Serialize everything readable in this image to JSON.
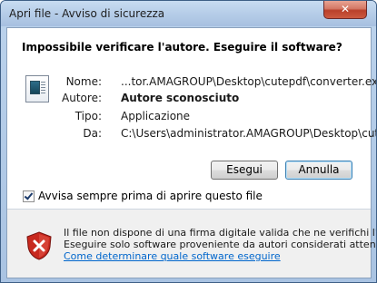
{
  "window": {
    "title": "Apri file - Avviso di sicurezza",
    "close_label": "✕"
  },
  "dialog": {
    "heading": "Impossibile verificare l'autore. Eseguire il software?",
    "fields": {
      "name_label": "Nome:",
      "name_value": "...tor.AMAGROUP\\Desktop\\cutepdf\\converter.exe",
      "author_label": "Autore:",
      "author_value": "Autore sconosciuto",
      "type_label": "Tipo:",
      "type_value": "Applicazione",
      "from_label": "Da:",
      "from_value": "C:\\Users\\administrator.AMAGROUP\\Desktop\\cut..."
    },
    "buttons": {
      "run_label": "Esegui",
      "cancel_label": "Annulla"
    },
    "checkbox": {
      "label": "Avvisa sempre prima di aprire questo file",
      "checked": true
    },
    "warning": {
      "line1": "Il file non dispone di una firma digitale valida che ne verifichi l'autore.",
      "line2": "Eseguire solo software proveniente da autori considerati attendibili.",
      "link": "Come determinare quale software eseguire",
      "icon": "shield-error-icon"
    }
  },
  "colors": {
    "link": "#0066cc",
    "shield_red": "#c8281e"
  }
}
